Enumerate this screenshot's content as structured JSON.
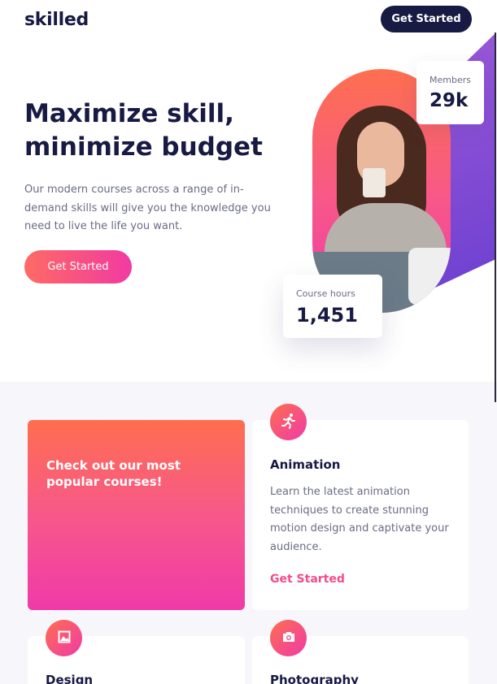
{
  "brand": {
    "logo": "skilled"
  },
  "nav": {
    "cta_label": "Get Started"
  },
  "hero": {
    "title_line1": "Maximize skill,",
    "title_line2": "minimize budget",
    "description": "Our modern courses across a range of in-demand skills will give you the knowledge you need to live the life you want.",
    "cta_label": "Get Started"
  },
  "stats": {
    "members": {
      "label": "Members",
      "value": "29k"
    },
    "course_hours": {
      "label": "Course hours",
      "value": "1,451"
    }
  },
  "promo": {
    "title": "Check out our most popular courses!"
  },
  "courses": [
    {
      "title": "Animation",
      "description": "Learn the latest animation techniques to create stunning motion design and captivate your audience.",
      "link_label": "Get Started",
      "icon": "running-figure-icon"
    },
    {
      "title": "Design",
      "icon": "image-icon"
    },
    {
      "title": "Photography",
      "icon": "camera-icon"
    }
  ],
  "colors": {
    "navy": "#171a42",
    "gradient_start": "#fe6e4f",
    "gradient_end": "#f03aa8",
    "link_pink": "#f34c8c",
    "purple_accent": "#8a4fd6"
  }
}
